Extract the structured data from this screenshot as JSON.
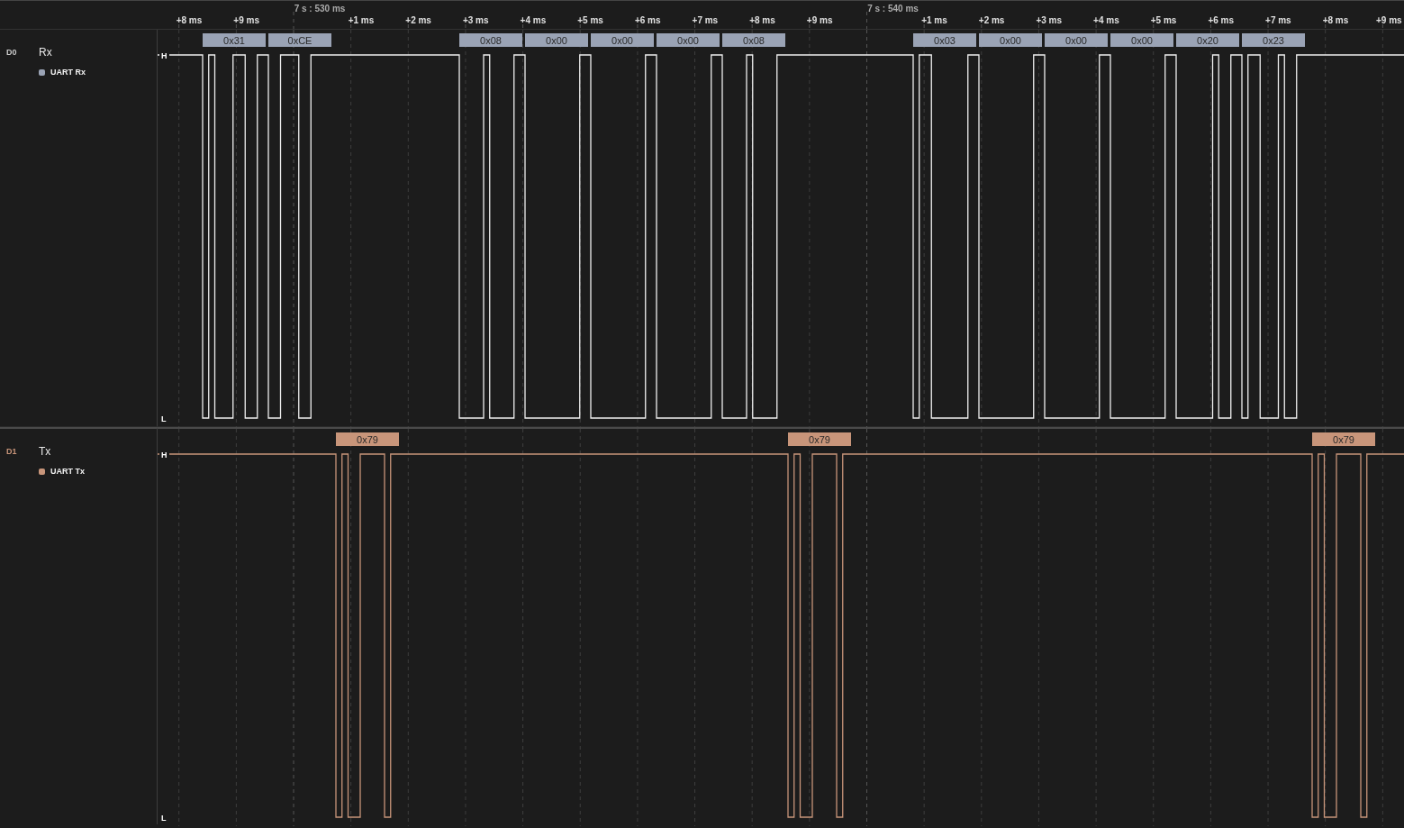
{
  "ruler": {
    "lead_ticks": [
      "+8 ms",
      "+9 ms"
    ],
    "segments": [
      {
        "label": "7 s : 530 ms",
        "ticks": [
          "+1 ms",
          "+2 ms",
          "+3 ms",
          "+4 ms",
          "+5 ms",
          "+6 ms",
          "+7 ms",
          "+8 ms",
          "+9 ms"
        ]
      },
      {
        "label": "7 s : 540 ms",
        "ticks": [
          "+1 ms",
          "+2 ms",
          "+3 ms",
          "+4 ms",
          "+5 ms",
          "+6 ms",
          "+7 ms",
          "+8 ms",
          "+9 ms"
        ]
      }
    ]
  },
  "channels": [
    {
      "id": "D0",
      "name": "Rx",
      "color": "#9aa3b5",
      "analyzer": "UART Rx",
      "high_mark": "H",
      "low_mark": "L",
      "frames": [
        "0x31",
        "0xCE",
        "0x08",
        "0x00",
        "0x00",
        "0x00",
        "0x08",
        "0x03",
        "0x00",
        "0x00",
        "0x00",
        "0x20",
        "0x23"
      ]
    },
    {
      "id": "D1",
      "name": "Tx",
      "color": "#c8957a",
      "analyzer": "UART Tx",
      "high_mark": "H",
      "low_mark": "L",
      "frames": [
        "0x79",
        "0x79",
        "0x79"
      ]
    }
  ]
}
